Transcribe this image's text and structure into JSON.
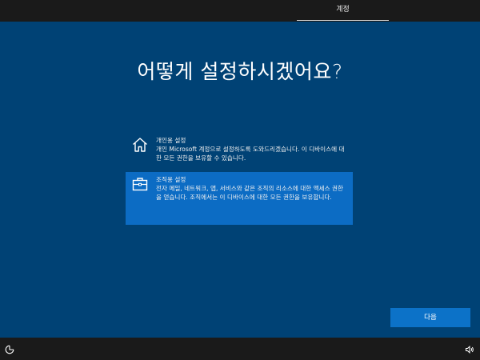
{
  "top_bar": {
    "tab_label": "계정"
  },
  "main": {
    "title": "어떻게 설정하시겠어요?",
    "options": [
      {
        "title": "개인용 설정",
        "description": "개인 Microsoft 계정으로 설정하도록 도와드리겠습니다. 이 디바이스에 대한 모든 권한을 보유할 수 있습니다.",
        "icon": "home-icon",
        "selected": false
      },
      {
        "title": "조직용 설정",
        "description": "전자 메일, 네트워크, 앱, 서비스와 같은 조직의 리소스에 대한 액세스 권한을 얻습니다. 조직에서는 이 디바이스에 대한 모든 권한을 보유합니다.",
        "icon": "briefcase-icon",
        "selected": true
      }
    ],
    "next_label": "다음"
  },
  "bottom_bar": {
    "left_icon": "ease-of-access-icon",
    "right_icon": "volume-icon"
  },
  "colors": {
    "background": "#004275",
    "bar": "#1a1a1a",
    "selected_option": "#0c6cc4",
    "button": "#0c72c8"
  }
}
